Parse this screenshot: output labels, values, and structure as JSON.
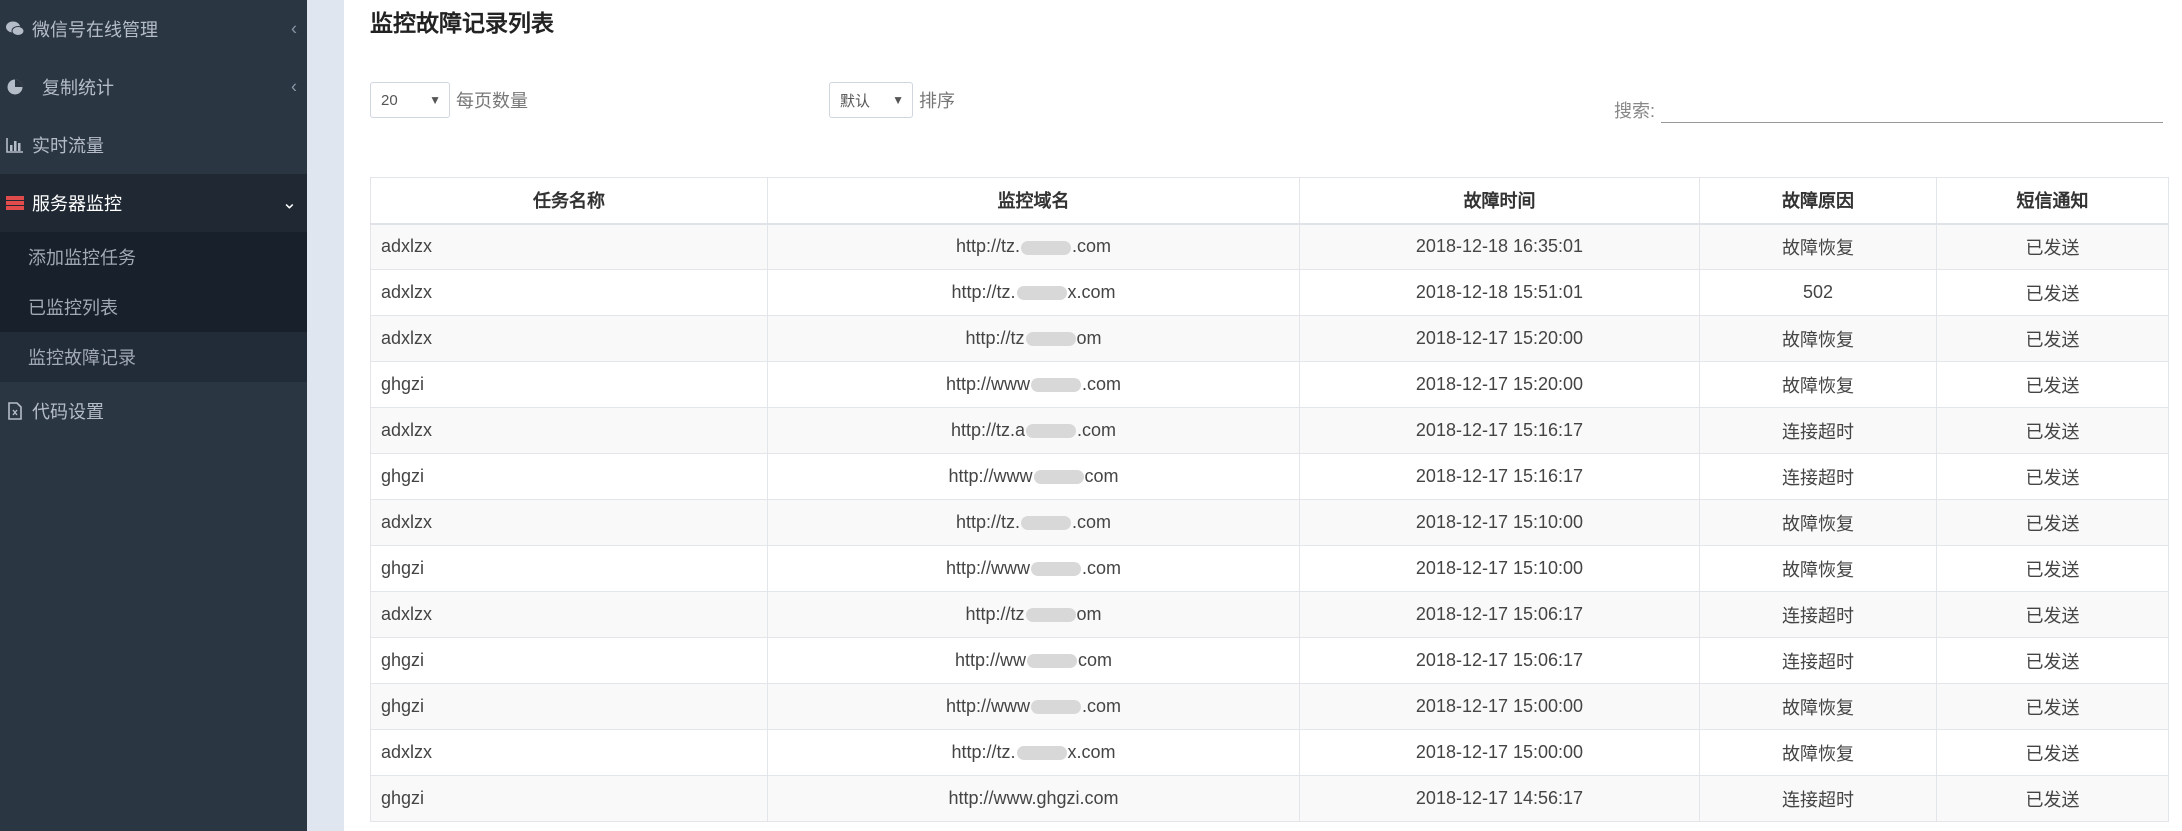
{
  "sidebar": {
    "items": [
      {
        "label": "微信号在线管理",
        "icon": "wechat-icon"
      },
      {
        "label": "复制统计",
        "icon": "pie-chart-icon"
      },
      {
        "label": "实时流量",
        "icon": "bar-chart-icon"
      },
      {
        "label": "服务器监控",
        "icon": "server-icon",
        "active": true
      },
      {
        "label": "代码设置",
        "icon": "code-file-icon"
      }
    ],
    "submenu": [
      {
        "label": "添加监控任务"
      },
      {
        "label": "已监控列表"
      },
      {
        "label": "监控故障记录",
        "active": true
      }
    ]
  },
  "main": {
    "title": "监控故障记录列表",
    "page_size": {
      "value": "20",
      "label": "每页数量"
    },
    "sort": {
      "value": "默认",
      "label": "排序"
    },
    "search": {
      "label": "搜索:",
      "value": ""
    }
  },
  "table": {
    "headers": [
      "任务名称",
      "监控域名",
      "故障时间",
      "故障原因",
      "短信通知"
    ],
    "rows": [
      {
        "task": "adxlzx",
        "domain_pre": "http://tz.",
        "domain_post": ".com",
        "time": "2018-12-18 16:35:01",
        "reason": "故障恢复",
        "sms": "已发送"
      },
      {
        "task": "adxlzx",
        "domain_pre": "http://tz.",
        "domain_post": "x.com",
        "time": "2018-12-18 15:51:01",
        "reason": "502",
        "sms": "已发送"
      },
      {
        "task": "adxlzx",
        "domain_pre": "http://tz",
        "domain_post": "om",
        "time": "2018-12-17 15:20:00",
        "reason": "故障恢复",
        "sms": "已发送"
      },
      {
        "task": "ghgzi",
        "domain_pre": "http://www",
        "domain_post": ".com",
        "time": "2018-12-17 15:20:00",
        "reason": "故障恢复",
        "sms": "已发送"
      },
      {
        "task": "adxlzx",
        "domain_pre": "http://tz.a",
        "domain_post": ".com",
        "time": "2018-12-17 15:16:17",
        "reason": "连接超时",
        "sms": "已发送"
      },
      {
        "task": "ghgzi",
        "domain_pre": "http://www",
        "domain_post": "com",
        "time": "2018-12-17 15:16:17",
        "reason": "连接超时",
        "sms": "已发送"
      },
      {
        "task": "adxlzx",
        "domain_pre": "http://tz.",
        "domain_post": ".com",
        "time": "2018-12-17 15:10:00",
        "reason": "故障恢复",
        "sms": "已发送"
      },
      {
        "task": "ghgzi",
        "domain_pre": "http://www",
        "domain_post": ".com",
        "time": "2018-12-17 15:10:00",
        "reason": "故障恢复",
        "sms": "已发送"
      },
      {
        "task": "adxlzx",
        "domain_pre": "http://tz",
        "domain_post": "om",
        "time": "2018-12-17 15:06:17",
        "reason": "连接超时",
        "sms": "已发送"
      },
      {
        "task": "ghgzi",
        "domain_pre": "http://ww",
        "domain_post": "com",
        "time": "2018-12-17 15:06:17",
        "reason": "连接超时",
        "sms": "已发送"
      },
      {
        "task": "ghgzi",
        "domain_pre": "http://www",
        "domain_post": ".com",
        "time": "2018-12-17 15:00:00",
        "reason": "故障恢复",
        "sms": "已发送"
      },
      {
        "task": "adxlzx",
        "domain_pre": "http://tz.",
        "domain_post": "x.com",
        "time": "2018-12-17 15:00:00",
        "reason": "故障恢复",
        "sms": "已发送"
      },
      {
        "task": "ghgzi",
        "domain_pre": "http://www.ghgzi.com",
        "domain_post": "",
        "time": "2018-12-17 14:56:17",
        "reason": "连接超时",
        "sms": "已发送"
      }
    ]
  },
  "colors": {
    "sidebar_bg": "#2b3643",
    "active_icon": "#e04b4b",
    "gutter": "#dfe6f0"
  }
}
